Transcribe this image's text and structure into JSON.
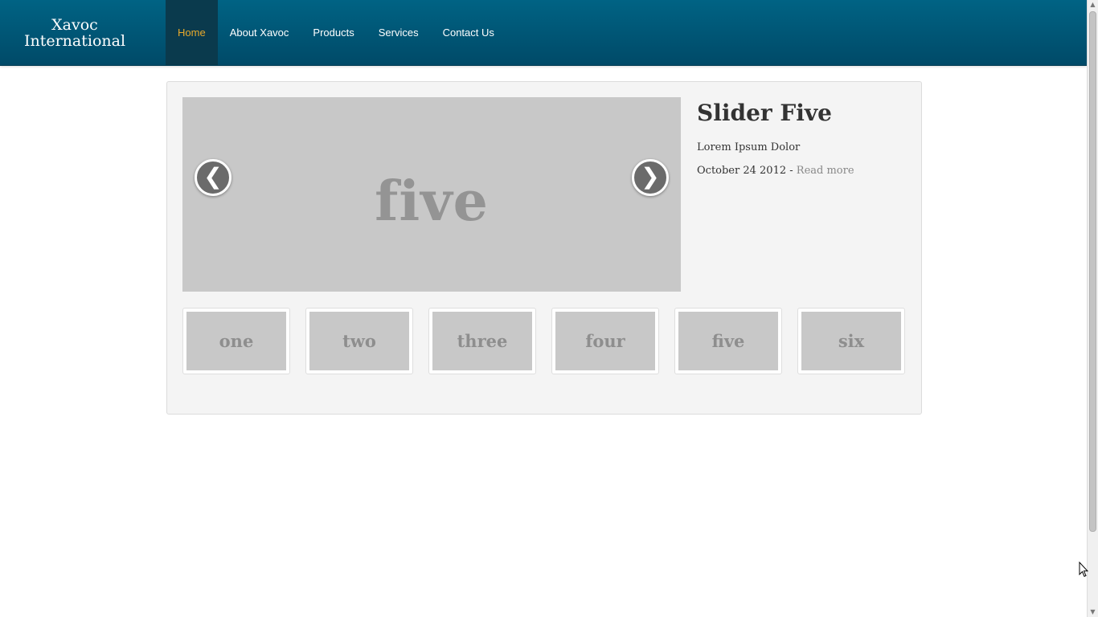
{
  "brand": {
    "name": "Xavoc\nInternational"
  },
  "nav": [
    {
      "label": "Home",
      "active": true
    },
    {
      "label": "About Xavoc",
      "active": false
    },
    {
      "label": "Products",
      "active": false
    },
    {
      "label": "Services",
      "active": false
    },
    {
      "label": "Contact Us",
      "active": false
    }
  ],
  "slider": {
    "current_slide_text": "five",
    "prev_glyph": "❮",
    "next_glyph": "❯",
    "caption": {
      "title": "Slider Five",
      "subtitle": "Lorem Ipsum Dolor",
      "date": "October 24 2012 - ",
      "read_more": "Read more"
    },
    "thumbnails": [
      "one",
      "two",
      "three",
      "four",
      "five",
      "six"
    ]
  },
  "scrollbar": {
    "up_glyph": "▲",
    "down_glyph": "▼"
  },
  "colors": {
    "header": "#005a79",
    "active_nav_text": "#e8a92b",
    "panel_bg": "#f4f4f4",
    "slide_bg": "#c8c8c8"
  }
}
